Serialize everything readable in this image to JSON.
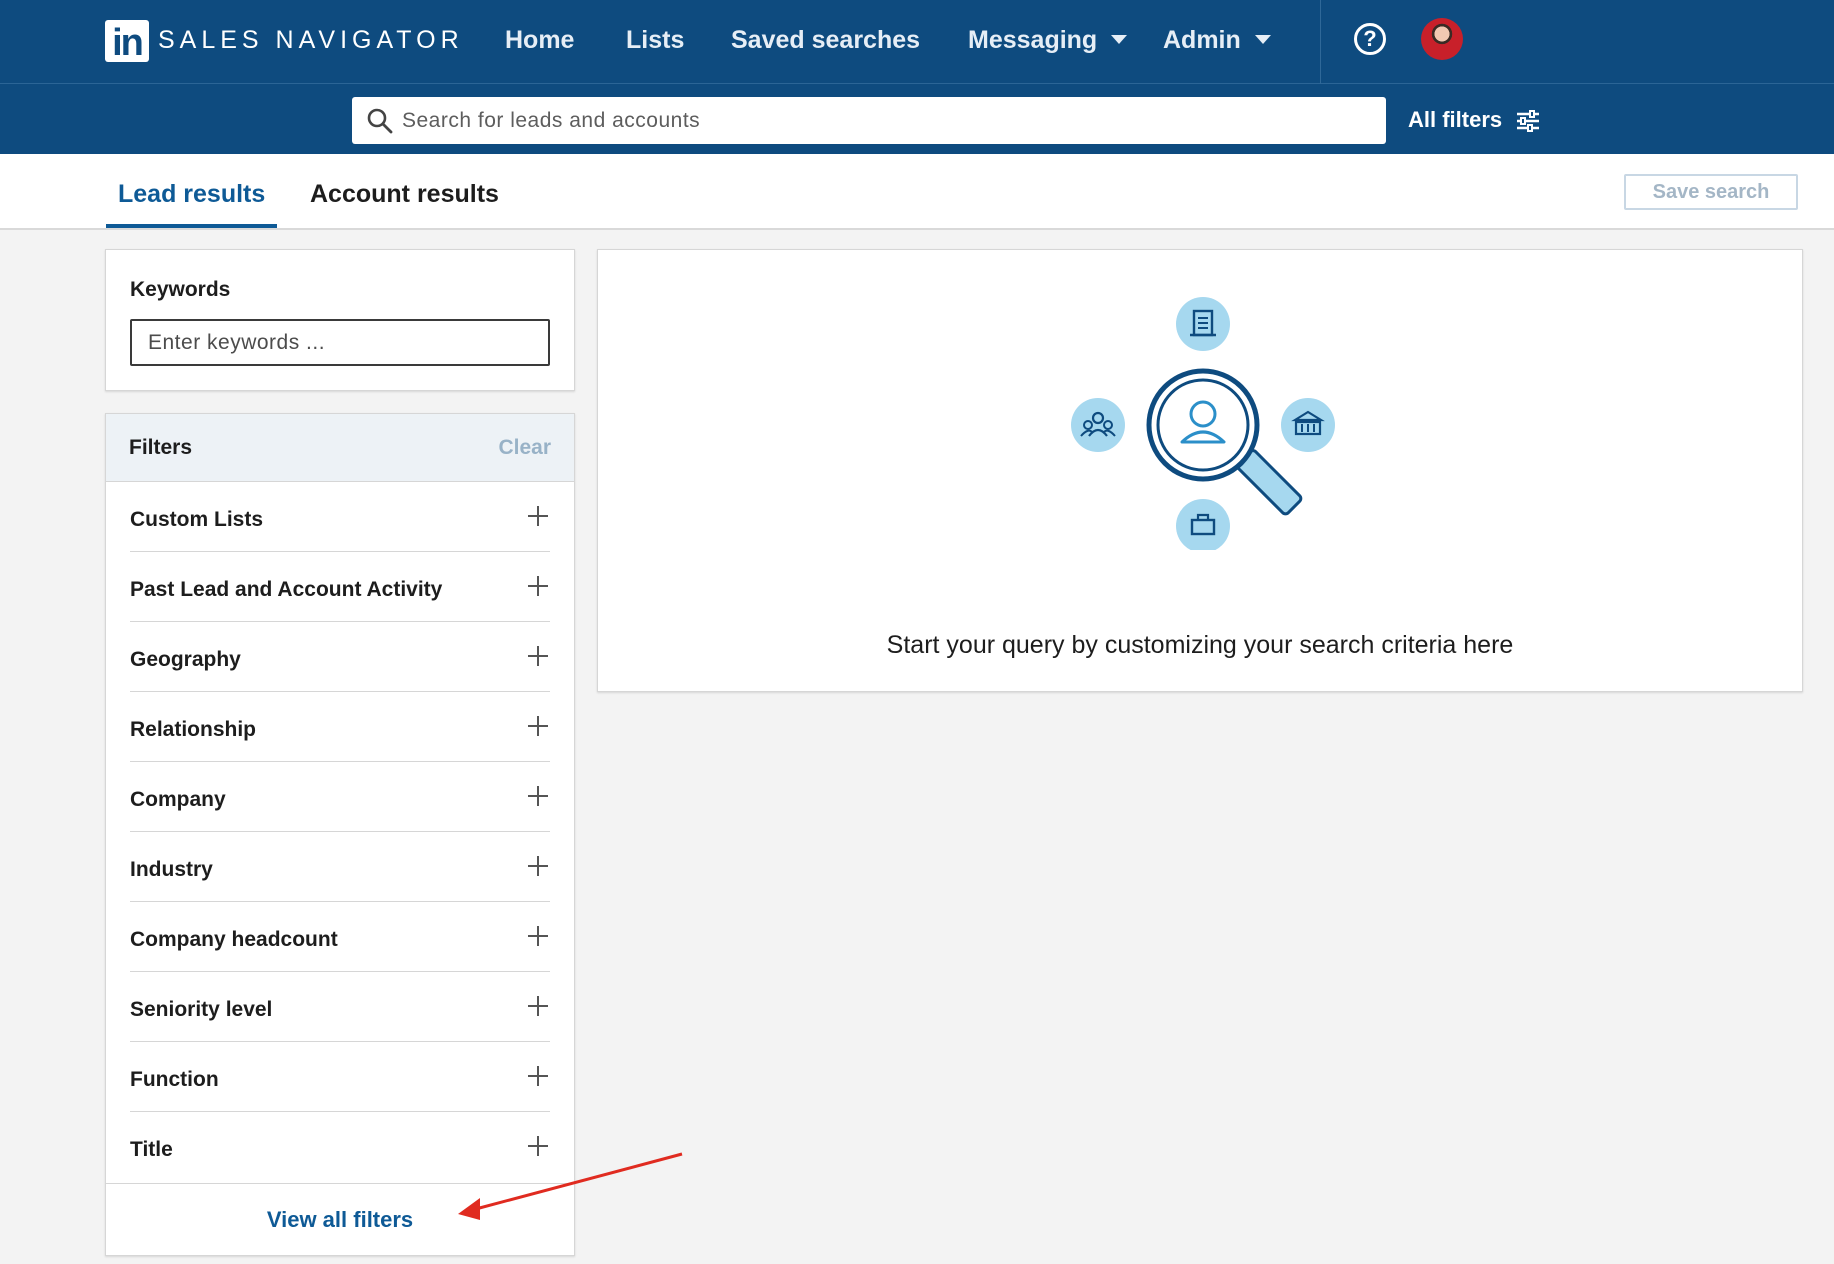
{
  "app": {
    "logo_text": "in",
    "brand": "SALES NAVIGATOR"
  },
  "nav": {
    "home": "Home",
    "lists": "Lists",
    "saved_searches": "Saved searches",
    "messaging": "Messaging",
    "admin": "Admin"
  },
  "search": {
    "placeholder": "Search for leads and accounts",
    "all_filters": "All filters"
  },
  "tabs": {
    "lead_results": "Lead results",
    "account_results": "Account results",
    "active": "Lead results"
  },
  "save_search": "Save search",
  "keywords": {
    "label": "Keywords",
    "placeholder": "Enter keywords ..."
  },
  "filters": {
    "title": "Filters",
    "clear": "Clear",
    "items": [
      {
        "label": "Custom Lists"
      },
      {
        "label": "Past Lead and Account Activity"
      },
      {
        "label": "Geography"
      },
      {
        "label": "Relationship"
      },
      {
        "label": "Company"
      },
      {
        "label": "Industry"
      },
      {
        "label": "Company headcount"
      },
      {
        "label": "Seniority level"
      },
      {
        "label": "Function"
      },
      {
        "label": "Title"
      }
    ],
    "view_all": "View all filters"
  },
  "main": {
    "message": "Start your query by customizing your search criteria here"
  },
  "colors": {
    "nav_bg": "#0e4b7f",
    "accent": "#0e5a96",
    "illustration_light": "#a6d8ef",
    "annotation_arrow": "#e02b20"
  },
  "icons": {
    "help": "help-circle-icon",
    "search": "search-icon",
    "filters": "sliders-icon",
    "plus": "plus-icon"
  }
}
